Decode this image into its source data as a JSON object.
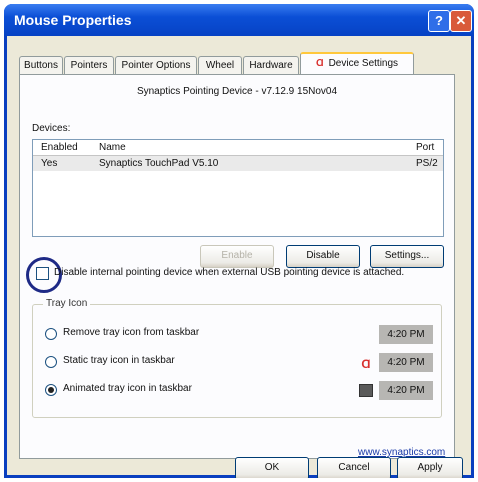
{
  "window": {
    "title": "Mouse Properties"
  },
  "title_buttons": {
    "help": "?",
    "close": "✕"
  },
  "tabs": [
    {
      "label": "Buttons"
    },
    {
      "label": "Pointers"
    },
    {
      "label": "Pointer Options"
    },
    {
      "label": "Wheel"
    },
    {
      "label": "Hardware"
    },
    {
      "label": "Device Settings",
      "active": true,
      "icon": "synaptics-logo-icon"
    }
  ],
  "device_settings": {
    "driver_title": "Synaptics Pointing Device - v7.12.9 15Nov04",
    "devices_label": "Devices:",
    "columns": [
      "Enabled",
      "Name",
      "Port"
    ],
    "rows": [
      {
        "enabled": "Yes",
        "name": "Synaptics TouchPad V5.10",
        "port": "PS/2"
      }
    ],
    "buttons": {
      "enable": "Enable",
      "disable": "Disable",
      "settings": "Settings..."
    },
    "disable_checkbox": {
      "label": "Disable internal pointing device when external USB pointing device is attached.",
      "checked": false
    },
    "tray": {
      "title": "Tray Icon",
      "options": [
        {
          "label": "Remove tray icon from taskbar",
          "selected": false,
          "time": "4:20 PM",
          "icon": "none"
        },
        {
          "label": "Static tray icon in taskbar",
          "selected": false,
          "time": "4:20 PM",
          "icon": "synaptics-logo-icon"
        },
        {
          "label": "Animated tray icon in taskbar",
          "selected": true,
          "time": "4:20 PM",
          "icon": "touchpad-icon"
        }
      ]
    },
    "link": "www.synaptics.com"
  },
  "footer": {
    "ok": "OK",
    "cancel": "Cancel",
    "apply": "Apply"
  },
  "colors": {
    "titlebar": "#0b4fd6",
    "accent_tab": "#ffc83c",
    "close_button": "#d95a3a",
    "link": "#1a3aa8"
  }
}
